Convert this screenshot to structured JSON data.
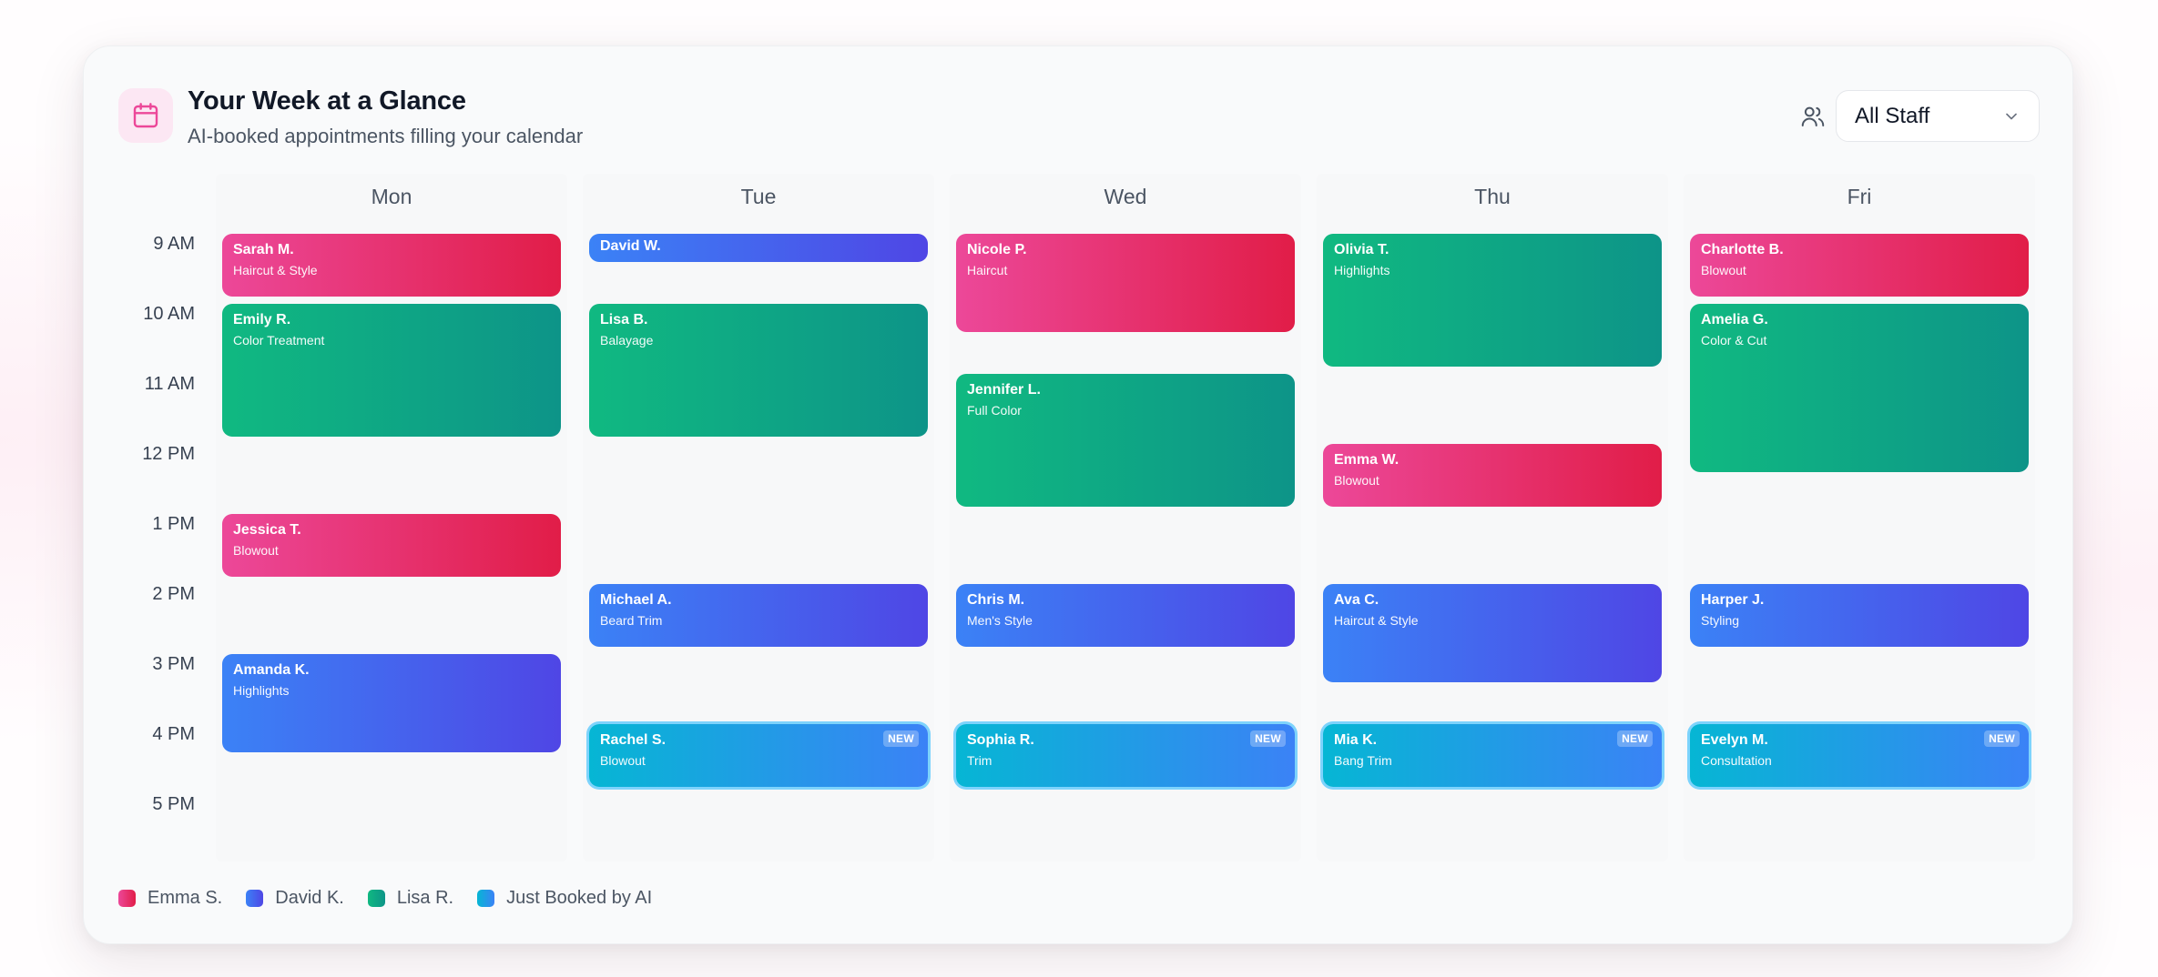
{
  "header": {
    "title": "Your Week at a Glance",
    "subtitle": "AI-booked appointments filling your calendar",
    "calendar_icon": "calendar-icon",
    "staff_icon": "users-icon",
    "staff_filter": "All Staff"
  },
  "days": [
    "Mon",
    "Tue",
    "Wed",
    "Thu",
    "Fri"
  ],
  "hours": [
    "9 AM",
    "10 AM",
    "11 AM",
    "12 PM",
    "1 PM",
    "2 PM",
    "3 PM",
    "4 PM",
    "5 PM"
  ],
  "colors": {
    "Emma S.": [
      "#ec4899",
      "#e11d48"
    ],
    "David K.": [
      "#3b82f6",
      "#4f46e5"
    ],
    "Lisa R.": [
      "#10b981",
      "#0d9488"
    ],
    "Just Booked by AI": [
      "#06b6d4",
      "#3b82f6"
    ]
  },
  "new_badge": "NEW",
  "appointments": [
    {
      "day": 0,
      "start": 9,
      "end": 10,
      "name": "Sarah M.",
      "service": "Haircut & Style",
      "staff": "Emma S."
    },
    {
      "day": 0,
      "start": 10,
      "end": 12,
      "name": "Emily R.",
      "service": "Color Treatment",
      "staff": "Lisa R."
    },
    {
      "day": 0,
      "start": 13,
      "end": 14,
      "name": "Jessica T.",
      "service": "Blowout",
      "staff": "Emma S."
    },
    {
      "day": 0,
      "start": 15,
      "end": 16.5,
      "name": "Amanda K.",
      "service": "Highlights",
      "staff": "David K."
    },
    {
      "day": 1,
      "start": 9,
      "end": 9.5,
      "name": "David W.",
      "service": "",
      "staff": "David K."
    },
    {
      "day": 1,
      "start": 10,
      "end": 12,
      "name": "Lisa B.",
      "service": "Balayage",
      "staff": "Lisa R."
    },
    {
      "day": 1,
      "start": 14,
      "end": 15,
      "name": "Michael A.",
      "service": "Beard Trim",
      "staff": "David K."
    },
    {
      "day": 1,
      "start": 16,
      "end": 17,
      "name": "Rachel S.",
      "service": "Blowout",
      "staff": "Just Booked by AI",
      "new": true
    },
    {
      "day": 2,
      "start": 9,
      "end": 10.5,
      "name": "Nicole P.",
      "service": "Haircut",
      "staff": "Emma S."
    },
    {
      "day": 2,
      "start": 11,
      "end": 13,
      "name": "Jennifer L.",
      "service": "Full Color",
      "staff": "Lisa R."
    },
    {
      "day": 2,
      "start": 14,
      "end": 15,
      "name": "Chris M.",
      "service": "Men's Style",
      "staff": "David K."
    },
    {
      "day": 2,
      "start": 16,
      "end": 17,
      "name": "Sophia R.",
      "service": "Trim",
      "staff": "Just Booked by AI",
      "new": true
    },
    {
      "day": 3,
      "start": 9,
      "end": 11,
      "name": "Olivia T.",
      "service": "Highlights",
      "staff": "Lisa R."
    },
    {
      "day": 3,
      "start": 12,
      "end": 13,
      "name": "Emma W.",
      "service": "Blowout",
      "staff": "Emma S."
    },
    {
      "day": 3,
      "start": 14,
      "end": 15.5,
      "name": "Ava C.",
      "service": "Haircut & Style",
      "staff": "David K."
    },
    {
      "day": 3,
      "start": 16,
      "end": 17,
      "name": "Mia K.",
      "service": "Bang Trim",
      "staff": "Just Booked by AI",
      "new": true
    },
    {
      "day": 4,
      "start": 9,
      "end": 10,
      "name": "Charlotte B.",
      "service": "Blowout",
      "staff": "Emma S."
    },
    {
      "day": 4,
      "start": 10,
      "end": 12.5,
      "name": "Amelia G.",
      "service": "Color & Cut",
      "staff": "Lisa R."
    },
    {
      "day": 4,
      "start": 14,
      "end": 15,
      "name": "Harper J.",
      "service": "Styling",
      "staff": "David K."
    },
    {
      "day": 4,
      "start": 16,
      "end": 17,
      "name": "Evelyn M.",
      "service": "Consultation",
      "staff": "Just Booked by AI",
      "new": true
    }
  ],
  "legend": [
    "Emma S.",
    "David K.",
    "Lisa R.",
    "Just Booked by AI"
  ]
}
